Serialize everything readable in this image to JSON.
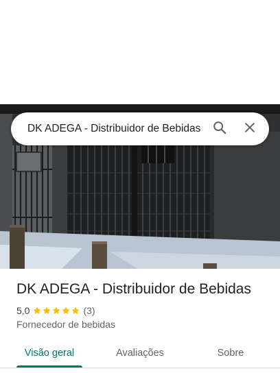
{
  "search": {
    "query": "DK ADEGA - Distribuidor de Bebidas"
  },
  "place": {
    "title": "DK ADEGA - Distribuidor de Bebidas",
    "rating": "5,0",
    "stars": 5,
    "review_count": "(3)",
    "category": "Fornecedor de bebidas"
  },
  "tabs": [
    {
      "label": "Visão geral",
      "active": true
    },
    {
      "label": "Avaliações",
      "active": false
    },
    {
      "label": "Sobre",
      "active": false
    }
  ],
  "colors": {
    "accent": "#00796b",
    "star": "#fbbc04"
  },
  "icons": {
    "search": "search-icon",
    "close": "close-icon",
    "star": "star-icon"
  }
}
